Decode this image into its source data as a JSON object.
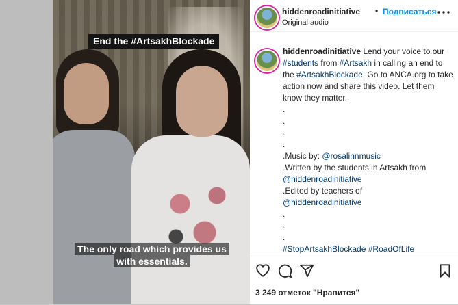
{
  "post": {
    "username": "hiddenroadinitiative",
    "dot": "•",
    "follow_label": "Подписаться",
    "audio": "Original audio",
    "more_icon": "more-horizontal-icon"
  },
  "video": {
    "top_caption": "End the #ArtsakhBlockade",
    "bottom_caption": "The only road which provides us with essentials."
  },
  "caption": {
    "username": "hiddenroadinitiative",
    "lines": [
      {
        "parts": [
          {
            "t": " Lend your voice to our "
          },
          {
            "t": "#students",
            "tag": true
          },
          {
            "t": " from "
          },
          {
            "t": "#Artsakh",
            "tag": true
          },
          {
            "t": " in calling an end to the "
          },
          {
            "t": "#ArtsakhBlockade",
            "tag": true
          },
          {
            "t": ". Go to ANCA.org to take action now and share this video. Let them know they matter."
          }
        ]
      }
    ],
    "dots1": [
      ".",
      ".",
      ".",
      "."
    ],
    "music_label": ".Music by: ",
    "music_user": "@rosalinnmusic",
    "written_label": ".Written by the students in Artsakh from ",
    "written_user": "@hiddenroadinitiative",
    "edited_label": ".Edited by teachers of",
    "edited_user": "@hiddenroadinitiative",
    "dots2": [
      ".",
      ".",
      "."
    ],
    "hashtag1": "#StopArtsakhBlockade",
    "hashtag2": "#RoadOfLife"
  },
  "actions": {
    "like_icon": "heart-icon",
    "comment_icon": "comment-icon",
    "share_icon": "paper-plane-icon",
    "save_icon": "bookmark-icon",
    "likes_text": "3 249 отметок \"Нравится\""
  },
  "colors": {
    "follow": "#0095f6",
    "hashtag": "#00376b",
    "avatar_ring": "#d6249f"
  }
}
